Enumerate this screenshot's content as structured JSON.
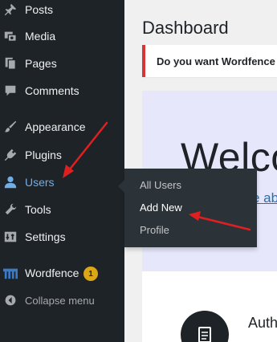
{
  "sidebar": {
    "items": [
      {
        "label": "Posts",
        "icon": "pin-icon"
      },
      {
        "label": "Media",
        "icon": "media-icon"
      },
      {
        "label": "Pages",
        "icon": "pages-icon"
      },
      {
        "label": "Comments",
        "icon": "comments-icon"
      },
      {
        "label": "Appearance",
        "icon": "paintbrush-icon"
      },
      {
        "label": "Plugins",
        "icon": "plugin-icon"
      },
      {
        "label": "Users",
        "icon": "user-icon"
      },
      {
        "label": "Tools",
        "icon": "wrench-icon"
      },
      {
        "label": "Settings",
        "icon": "settings-icon"
      },
      {
        "label": "Wordfence",
        "icon": "wordfence-icon",
        "badge": "1"
      },
      {
        "label": "Collapse menu",
        "icon": "collapse-icon"
      }
    ],
    "active_item": "Users"
  },
  "users_submenu": {
    "items": [
      "All Users",
      "Add New",
      "Profile"
    ]
  },
  "main": {
    "page_title": "Dashboard",
    "notice_text": "Do you want Wordfence to",
    "welcome_heading": "Welco",
    "welcome_link": "e ab",
    "author_text": "Auth"
  },
  "colors": {
    "sidebar_bg": "#1d2327",
    "flyout_bg": "#2c3338",
    "active_blue": "#72aee6",
    "annotation_red": "#e02020",
    "badge": "#dba617"
  }
}
